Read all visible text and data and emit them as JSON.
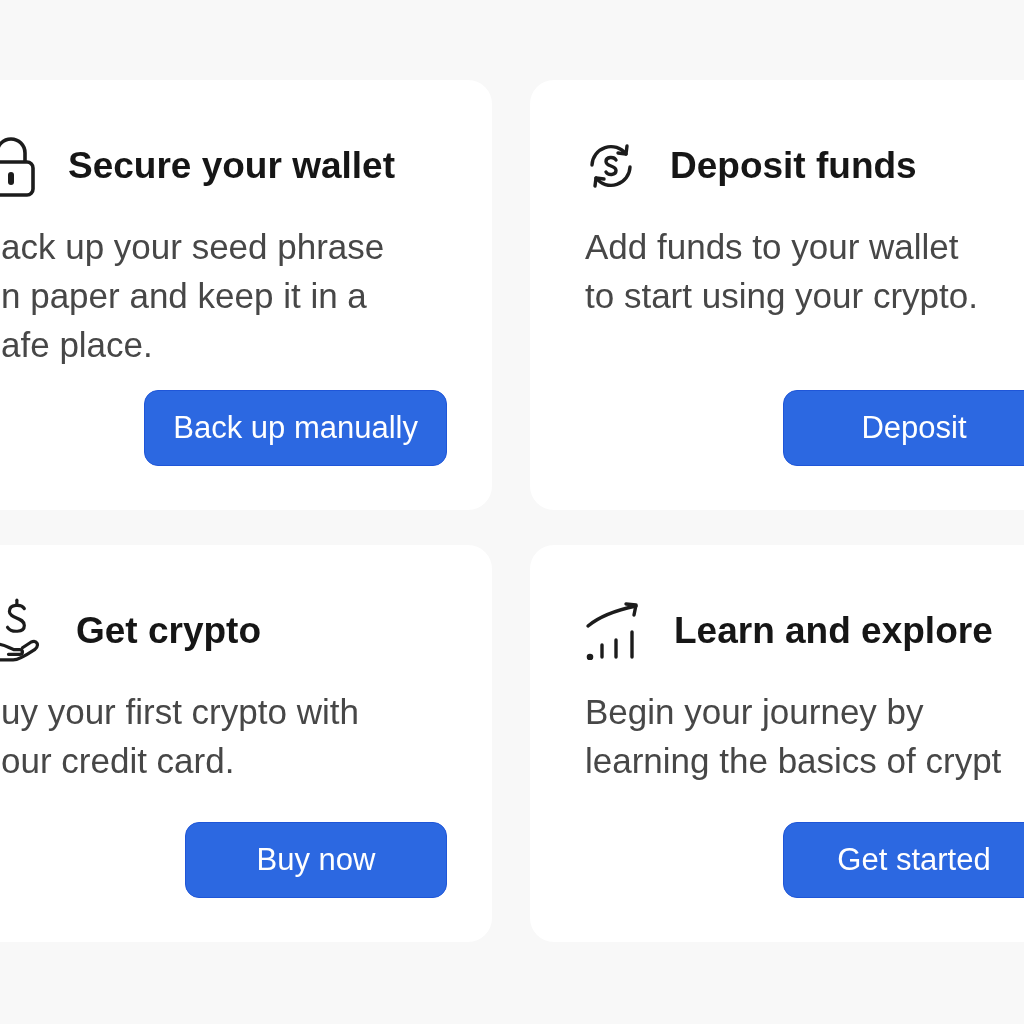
{
  "cards": [
    {
      "title": "Secure your wallet",
      "description_lines": [
        "ack up your seed phrase",
        "n paper and keep it in a",
        "afe place."
      ],
      "button": "Back up manually"
    },
    {
      "title": "Deposit funds",
      "description_lines": [
        "Add funds to your wallet",
        "to start using your crypto."
      ],
      "button": "Deposit"
    },
    {
      "title": "Get crypto",
      "description_lines": [
        "uy your first crypto with",
        "our credit card."
      ],
      "button": "Buy now"
    },
    {
      "title": "Learn and explore",
      "description_lines": [
        "Begin your journey by",
        "learning the basics of crypt"
      ],
      "button": "Get started"
    }
  ]
}
